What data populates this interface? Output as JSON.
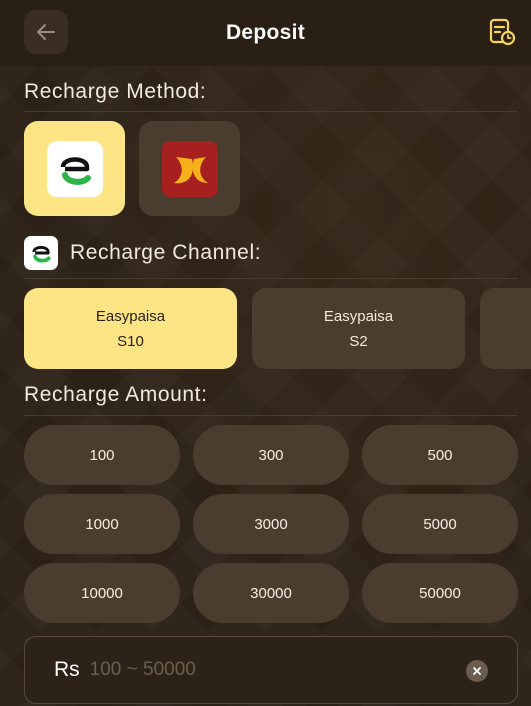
{
  "header": {
    "title": "Deposit",
    "back_icon": "arrow-left-icon",
    "history_icon": "document-clock-icon"
  },
  "recharge_method": {
    "label": "Recharge Method:",
    "options": [
      {
        "name": "Easypaisa",
        "icon": "easypaisa-logo-icon",
        "selected": true
      },
      {
        "name": "JazzCash",
        "icon": "jazzcash-logo-icon",
        "selected": false
      }
    ]
  },
  "recharge_channel": {
    "label": "Recharge Channel:",
    "channels": [
      {
        "line1": "Easypaisa",
        "line2": "S10",
        "selected": true
      },
      {
        "line1": "Easypaisa",
        "line2": "S2",
        "selected": false
      }
    ]
  },
  "recharge_amount": {
    "label": "Recharge Amount:",
    "amounts": [
      "100",
      "300",
      "500",
      "1000",
      "3000",
      "5000",
      "10000",
      "30000",
      "50000"
    ]
  },
  "amount_input": {
    "currency": "Rs",
    "value": "",
    "placeholder": "100 ~ 50000"
  },
  "colors": {
    "background": "#2e2318",
    "accent": "#fde586",
    "card": "#4a3d30",
    "easypaisa_green": "#2fb44a",
    "jazzcash_red": "#a5201e"
  }
}
